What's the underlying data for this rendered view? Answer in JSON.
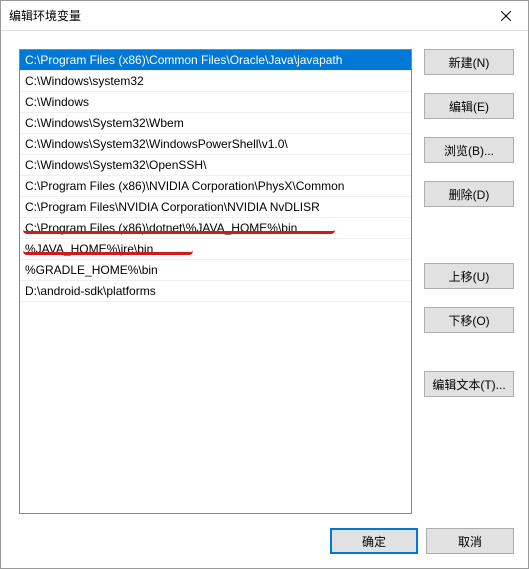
{
  "window": {
    "title": "编辑环境变量"
  },
  "list": {
    "items": [
      "C:\\Program Files (x86)\\Common Files\\Oracle\\Java\\javapath",
      "C:\\Windows\\system32",
      "C:\\Windows",
      "C:\\Windows\\System32\\Wbem",
      "C:\\Windows\\System32\\WindowsPowerShell\\v1.0\\",
      "C:\\Windows\\System32\\OpenSSH\\",
      "C:\\Program Files (x86)\\NVIDIA Corporation\\PhysX\\Common",
      "C:\\Program Files\\NVIDIA Corporation\\NVIDIA NvDLISR",
      "C:\\Program Files (x86)\\dotnet\\%JAVA_HOME%\\bin",
      "%JAVA_HOME%\\jre\\bin",
      "%GRADLE_HOME%\\bin",
      "D:\\android-sdk\\platforms"
    ],
    "selected_index": 0
  },
  "buttons": {
    "new": "新建(N)",
    "edit": "编辑(E)",
    "browse": "浏览(B)...",
    "delete": "删除(D)",
    "moveup": "上移(U)",
    "movedown": "下移(O)",
    "edittext": "编辑文本(T)...",
    "ok": "确定",
    "cancel": "取消"
  }
}
